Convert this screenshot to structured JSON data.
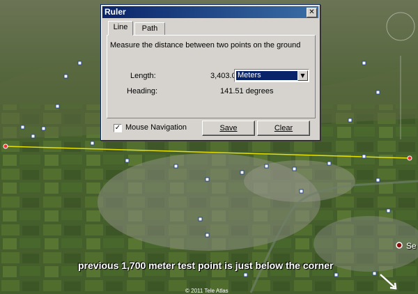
{
  "dialog": {
    "title": "Ruler",
    "close_glyph": "✕",
    "tabs": [
      {
        "label": "Line",
        "active": true
      },
      {
        "label": "Path",
        "active": false
      }
    ],
    "description": "Measure the distance between two points on the ground",
    "length_label": "Length:",
    "length_value": "3,403.03",
    "unit_selected": "Meters",
    "heading_label": "Heading:",
    "heading_value": "141.51 degrees",
    "mouse_nav_label": "Mouse Navigation",
    "mouse_nav_checked": true,
    "save_label": "Save",
    "clear_label": "Clear"
  },
  "map": {
    "caption": "previous 1,700 meter test point is just below the corner",
    "attribution": "© 2011 Tele Atlas",
    "place_label": "Se",
    "measure_line_color": "#e8e000"
  }
}
